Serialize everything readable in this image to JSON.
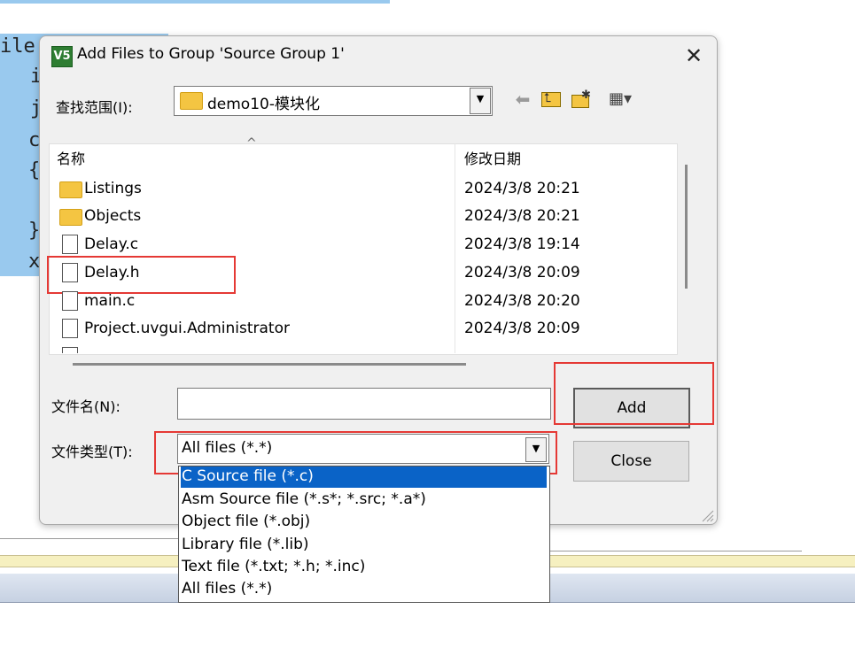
{
  "background_editor": {
    "code_fragments": [
      "ile",
      "i",
      "j",
      "c",
      "{",
      "}",
      "x"
    ]
  },
  "dialog": {
    "app_icon": "V5",
    "title": "Add Files to Group 'Source Group 1'",
    "close_glyph": "✕",
    "look_in_label": "查找范围(I):",
    "look_in_value": "demo10-模块化",
    "toolbar": {
      "back_icon": "⬅",
      "up_icon": "⮤",
      "new_folder_icon": "✱",
      "view_menu_icon": "▦▾"
    },
    "columns": {
      "name": "名称",
      "modified": "修改日期"
    },
    "files": [
      {
        "name": "Listings",
        "date": "2024/3/8 20:21",
        "kind": "folder"
      },
      {
        "name": "Objects",
        "date": "2024/3/8 20:21",
        "kind": "folder"
      },
      {
        "name": "Delay.c",
        "date": "2024/3/8 19:14",
        "kind": "file"
      },
      {
        "name": "Delay.h",
        "date": "2024/3/8 20:09",
        "kind": "file"
      },
      {
        "name": "main.c",
        "date": "2024/3/8 20:20",
        "kind": "file"
      },
      {
        "name": "Project.uvgui.Administrator",
        "date": "2024/3/8 20:09",
        "kind": "file"
      }
    ],
    "filename_label": "文件名(N):",
    "filename_value": "",
    "filetype_label": "文件类型(T):",
    "filetype_value": "All files (*.*)",
    "add_button": "Add",
    "close_button": "Close",
    "filetype_options": [
      "C Source file (*.c)",
      "Asm Source file (*.s*; *.src; *.a*)",
      "Object file (*.obj)",
      "Library file (*.lib)",
      "Text file (*.txt; *.h; *.inc)",
      "All files (*.*)"
    ],
    "highlighted_option_index": 0,
    "colors": {
      "selection": "#0a63c7",
      "annotation_red": "#e53935"
    }
  }
}
